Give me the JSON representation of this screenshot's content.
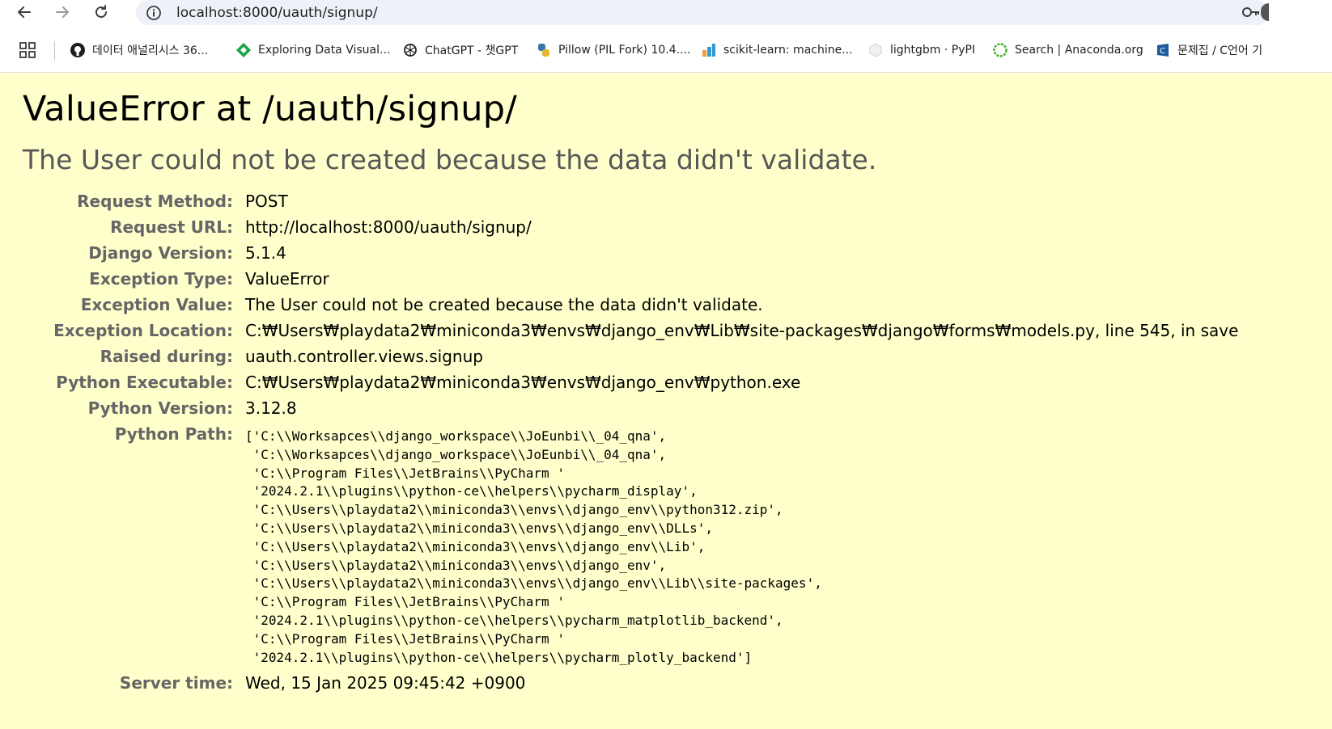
{
  "browser": {
    "url": "localhost:8000/uauth/signup/"
  },
  "bookmarks": [
    {
      "label": "데이터 애널리시스 36...",
      "icon": "github-icon"
    },
    {
      "label": "Exploring Data Visual...",
      "icon": "diamond-logo-icon"
    },
    {
      "label": "ChatGPT - 챗GPT",
      "icon": "chatgpt-icon"
    },
    {
      "label": "Pillow (PIL Fork) 10.4....",
      "icon": "python-icon"
    },
    {
      "label": "scikit-learn: machine...",
      "icon": "scikit-learn-icon"
    },
    {
      "label": "lightgbm · PyPI",
      "icon": "pypi-box-icon"
    },
    {
      "label": "Search | Anaconda.org",
      "icon": "anaconda-icon"
    },
    {
      "label": "문제집 / C언어 기",
      "icon": "codeup-icon"
    }
  ],
  "error": {
    "title": "ValueError at /uauth/signup/",
    "message": "The User could not be created because the data didn't validate."
  },
  "meta": {
    "request_method": {
      "label": "Request Method:",
      "value": "POST"
    },
    "request_url": {
      "label": "Request URL:",
      "value": "http://localhost:8000/uauth/signup/"
    },
    "django_version": {
      "label": "Django Version:",
      "value": "5.1.4"
    },
    "exception_type": {
      "label": "Exception Type:",
      "value": "ValueError"
    },
    "exception_value": {
      "label": "Exception Value:",
      "value": "The User could not be created because the data didn't validate."
    },
    "exception_location": {
      "label": "Exception Location:",
      "value": "C:₩Users₩playdata2₩miniconda3₩envs₩django_env₩Lib₩site-packages₩django₩forms₩models.py, line 545, in save"
    },
    "raised_during": {
      "label": "Raised during:",
      "value": "uauth.controller.views.signup"
    },
    "python_executable": {
      "label": "Python Executable:",
      "value": "C:₩Users₩playdata2₩miniconda3₩envs₩django_env₩python.exe"
    },
    "python_version": {
      "label": "Python Version:",
      "value": "3.12.8"
    },
    "python_path": {
      "label": "Python Path:",
      "lines": [
        "['C:\\\\Worksapces\\\\django_workspace\\\\JoEunbi\\\\_04_qna',",
        " 'C:\\\\Worksapces\\\\django_workspace\\\\JoEunbi\\\\_04_qna',",
        " 'C:\\\\Program Files\\\\JetBrains\\\\PyCharm '",
        " '2024.2.1\\\\plugins\\\\python-ce\\\\helpers\\\\pycharm_display',",
        " 'C:\\\\Users\\\\playdata2\\\\miniconda3\\\\envs\\\\django_env\\\\python312.zip',",
        " 'C:\\\\Users\\\\playdata2\\\\miniconda3\\\\envs\\\\django_env\\\\DLLs',",
        " 'C:\\\\Users\\\\playdata2\\\\miniconda3\\\\envs\\\\django_env\\\\Lib',",
        " 'C:\\\\Users\\\\playdata2\\\\miniconda3\\\\envs\\\\django_env',",
        " 'C:\\\\Users\\\\playdata2\\\\miniconda3\\\\envs\\\\django_env\\\\Lib\\\\site-packages',",
        " 'C:\\\\Program Files\\\\JetBrains\\\\PyCharm '",
        " '2024.2.1\\\\plugins\\\\python-ce\\\\helpers\\\\pycharm_matplotlib_backend',",
        " 'C:\\\\Program Files\\\\JetBrains\\\\PyCharm '",
        " '2024.2.1\\\\plugins\\\\python-ce\\\\helpers\\\\pycharm_plotly_backend']"
      ]
    },
    "server_time": {
      "label": "Server time:",
      "value": "Wed, 15 Jan 2025 09:45:42 +0900"
    }
  }
}
